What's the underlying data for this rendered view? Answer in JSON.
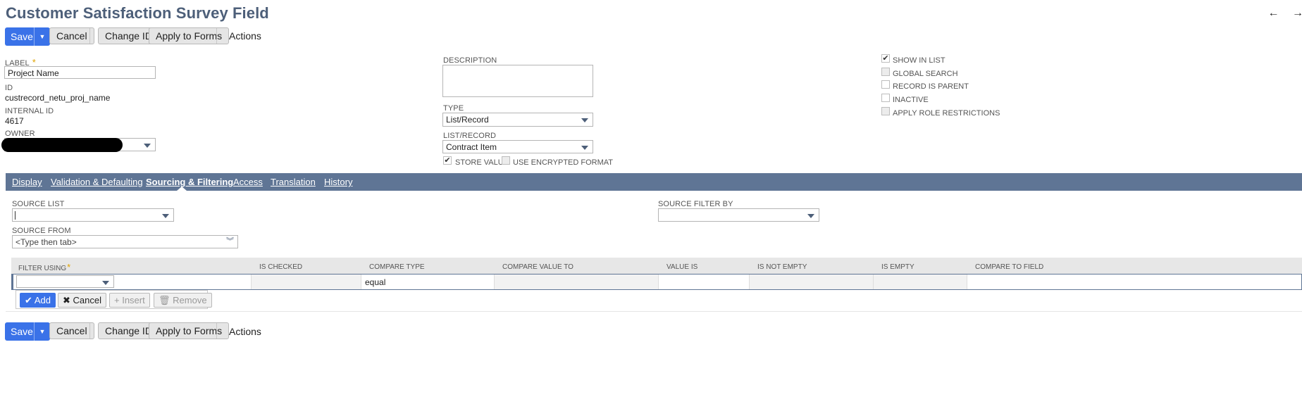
{
  "page": {
    "title": "Customer Satisfaction Survey Field"
  },
  "nav": {
    "back": "←",
    "forward": "→"
  },
  "toolbar": {
    "save_label": "Save",
    "cancel_label": "Cancel",
    "change_id_label": "Change ID",
    "apply_forms_label": "Apply to Forms",
    "actions_label": "Actions"
  },
  "fields": {
    "label": {
      "label": "LABEL",
      "required": "*",
      "value": "Project Name"
    },
    "id": {
      "label": "ID",
      "value": "custrecord_netu_proj_name"
    },
    "internal_id": {
      "label": "INTERNAL ID",
      "value": "4617"
    },
    "owner": {
      "label": "OWNER",
      "value": ""
    },
    "description": {
      "label": "DESCRIPTION",
      "value": ""
    },
    "type": {
      "label": "TYPE",
      "value": "List/Record"
    },
    "list_record": {
      "label": "LIST/RECORD",
      "value": "Contract Item"
    },
    "store_value": {
      "label": "STORE VALUE",
      "checked": true
    },
    "use_encrypted": {
      "label": "USE ENCRYPTED FORMAT",
      "checked": false
    }
  },
  "checkboxes": [
    {
      "label": "SHOW IN LIST",
      "checked": true,
      "disabled": false
    },
    {
      "label": "GLOBAL SEARCH",
      "checked": false,
      "disabled": true
    },
    {
      "label": "RECORD IS PARENT",
      "checked": false,
      "disabled": false
    },
    {
      "label": "INACTIVE",
      "checked": false,
      "disabled": false
    },
    {
      "label": "APPLY ROLE RESTRICTIONS",
      "checked": false,
      "disabled": true
    }
  ],
  "tabs": [
    {
      "label": "Display",
      "active": false
    },
    {
      "label": "Validation & Defaulting",
      "active": false
    },
    {
      "label": "Sourcing & Filtering",
      "active": true
    },
    {
      "label": "Access",
      "active": false
    },
    {
      "label": "Translation",
      "active": false
    },
    {
      "label": "History",
      "active": false
    }
  ],
  "sourcing": {
    "source_list": {
      "label": "SOURCE LIST",
      "value": ""
    },
    "source_filter_by": {
      "label": "SOURCE FILTER BY",
      "value": ""
    },
    "source_from": {
      "label": "SOURCE FROM",
      "placeholder": "<Type then tab>"
    }
  },
  "filter_table": {
    "columns": [
      "FILTER USING",
      "IS CHECKED",
      "COMPARE TYPE",
      "COMPARE VALUE TO",
      "VALUE IS",
      "IS NOT EMPTY",
      "IS EMPTY",
      "COMPARE TO FIELD"
    ],
    "required_marker": "*",
    "row": {
      "compare_type": "equal"
    }
  },
  "machine_buttons": {
    "add_label": "Add",
    "cancel_label": "Cancel",
    "insert_label": "Insert",
    "remove_label": "Remove"
  },
  "colors": {
    "accent": "#3a72e8",
    "tabbar": "#5f7595",
    "title": "#4d5f79",
    "required": "#e0a300"
  }
}
